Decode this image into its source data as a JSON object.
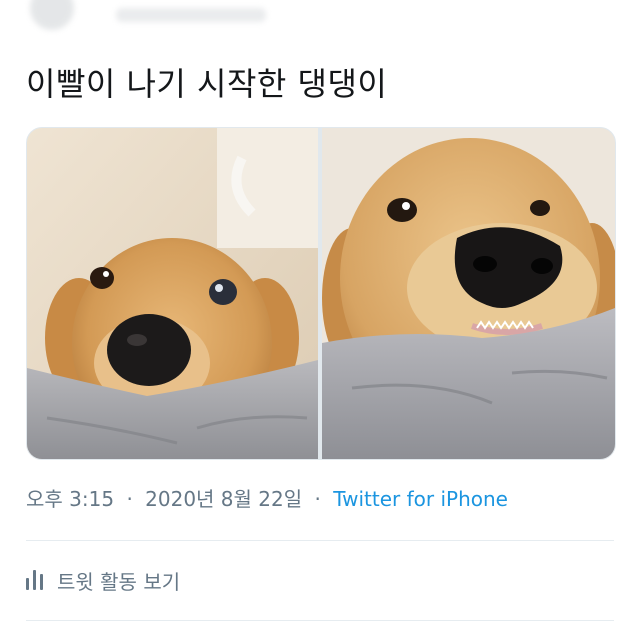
{
  "tweet": {
    "text": "이빨이 나기 시작한 댕댕이",
    "timestamp": "오후 3:15",
    "separator": "·",
    "date": "2020년 8월 22일",
    "source": "Twitter for iPhone"
  },
  "actions": {
    "activity_label": "트윗 활동 보기",
    "activity_icon": "bar-chart-icon"
  },
  "colors": {
    "text": "#14171a",
    "muted": "#657786",
    "link": "#1b95e0",
    "divider": "#e6ecf0"
  }
}
